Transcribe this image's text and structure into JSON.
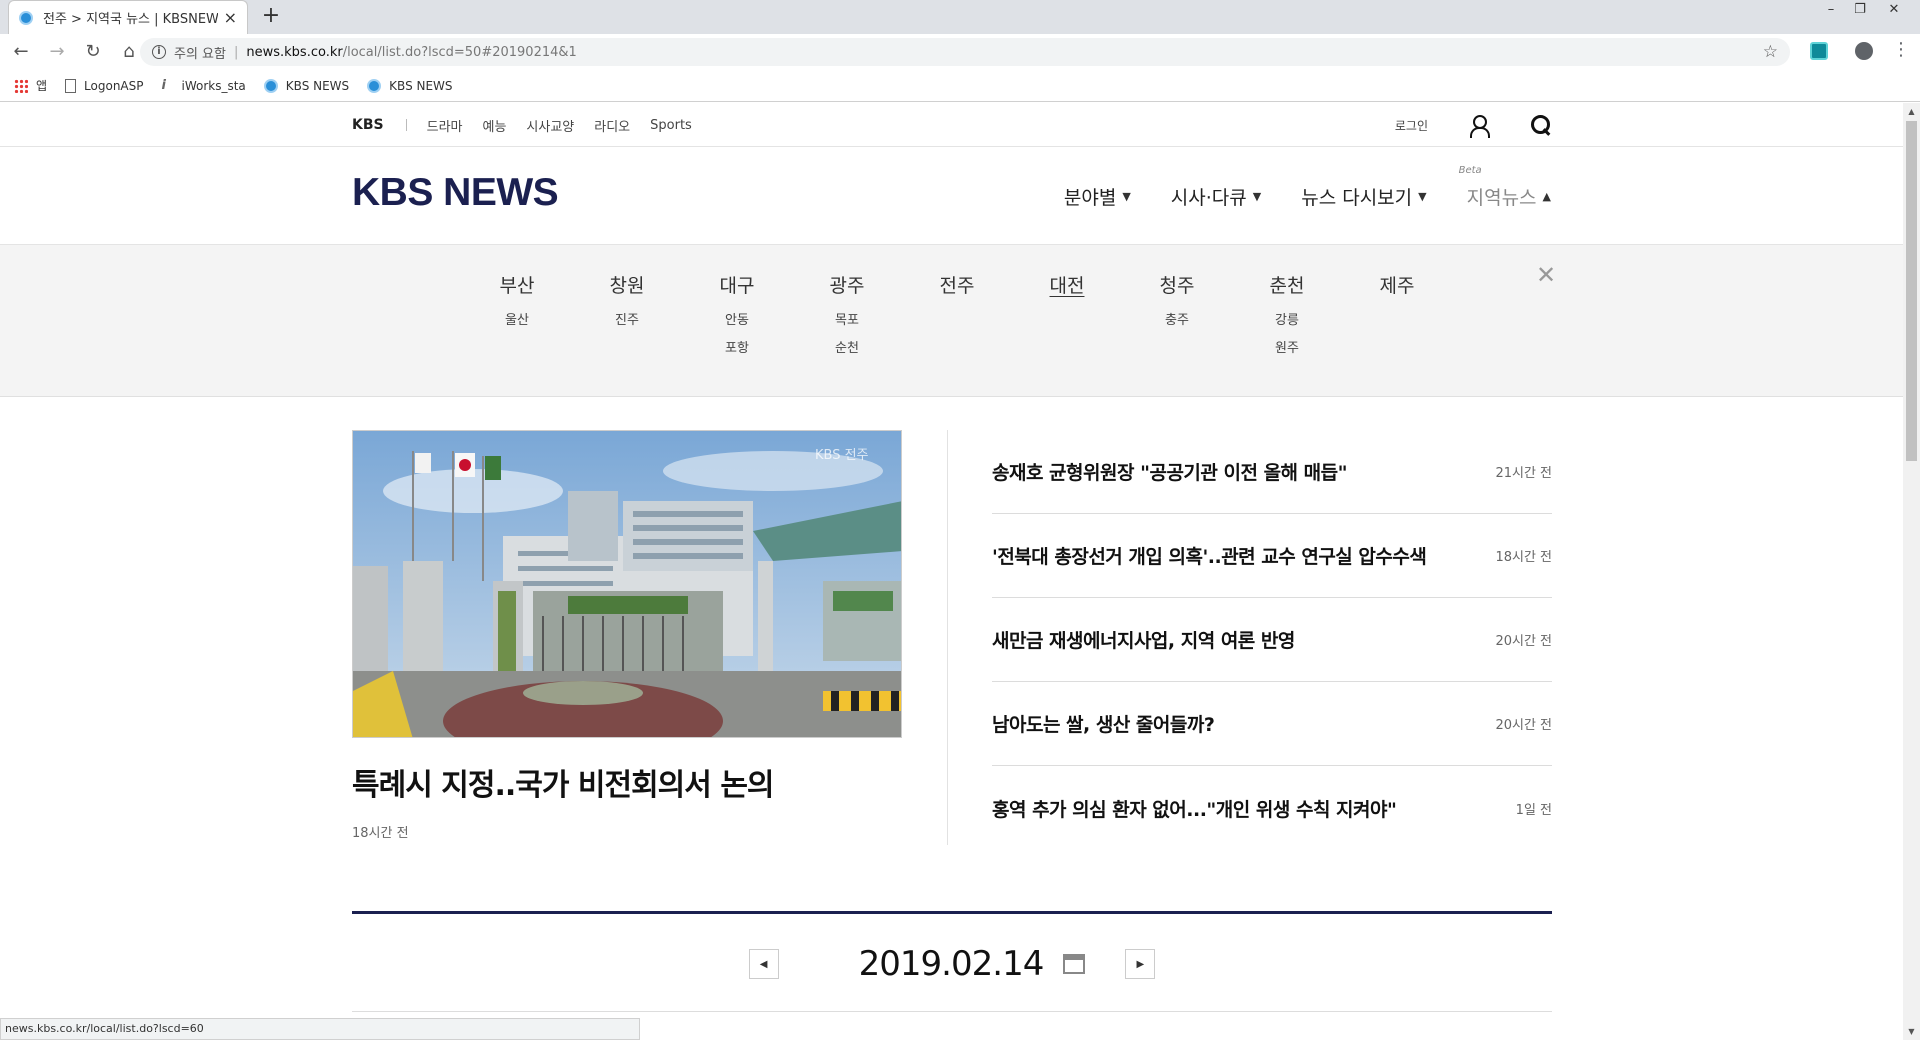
{
  "browser": {
    "tab_title": "전주 > 지역국 뉴스 | KBSNEWS",
    "tab_close": "×",
    "new_tab": "+",
    "security_warning": "주의 요함",
    "url_host": "news.kbs.co.kr",
    "url_path": "/local/list.do?lscd=50#20190214&1",
    "bookmarks": [
      {
        "label": "앱",
        "icon": "apps-icon"
      },
      {
        "label": "LogonASP",
        "icon": "document-icon"
      },
      {
        "label": "iWorks_sta",
        "icon": "iworks-icon"
      },
      {
        "label": "KBS NEWS",
        "icon": "kbs-icon"
      },
      {
        "label": "KBS NEWS",
        "icon": "kbs-icon"
      }
    ],
    "status_text": "news.kbs.co.kr/local/list.do?lscd=60"
  },
  "gnb": {
    "kbs": "KBS",
    "items": [
      "드라마",
      "예능",
      "시사교양",
      "라디오",
      "Sports"
    ],
    "login": "로그인"
  },
  "header": {
    "logo": "KBS NEWS",
    "nav": [
      {
        "label": "분야별",
        "caret": "▼"
      },
      {
        "label": "시사·다큐",
        "caret": "▼"
      },
      {
        "label": "뉴스 다시보기",
        "caret": "▼"
      },
      {
        "label": "지역뉴스",
        "caret": "▲",
        "badge": "Beta"
      }
    ]
  },
  "regions": [
    {
      "name": "부산",
      "subs": [
        "울산"
      ]
    },
    {
      "name": "창원",
      "subs": [
        "진주"
      ]
    },
    {
      "name": "대구",
      "subs": [
        "안동",
        "포항"
      ]
    },
    {
      "name": "광주",
      "subs": [
        "목포",
        "순천"
      ]
    },
    {
      "name": "전주",
      "subs": []
    },
    {
      "name": "대전",
      "subs": [],
      "current": true
    },
    {
      "name": "청주",
      "subs": [
        "충주"
      ]
    },
    {
      "name": "춘천",
      "subs": [
        "강릉",
        "원주"
      ]
    },
    {
      "name": "제주",
      "subs": []
    }
  ],
  "region_close": "✕",
  "headline": {
    "title": "특례시 지정..국가 비전회의서 논의",
    "time": "18시간 전",
    "image_watermark": "KBS 전주"
  },
  "news": [
    {
      "title": "송재호 균형위원장 \"공공기관 이전 올해 매듭\"",
      "time": "21시간 전"
    },
    {
      "title": "'전북대 총장선거 개입 의혹'..관련 교수 연구실 압수수색",
      "time": "18시간 전"
    },
    {
      "title": "새만금 재생에너지사업, 지역 여론 반영",
      "time": "20시간 전"
    },
    {
      "title": "남아도는 쌀, 생산 줄어들까?",
      "time": "20시간 전"
    },
    {
      "title": "홍역 추가 의심 환자 없어...\"개인 위생 수칙 지켜야\"",
      "time": "1일 전"
    }
  ],
  "date_nav": {
    "date": "2019.02.14",
    "prev": "◀",
    "next": "▶"
  },
  "colors": {
    "brand_navy": "#1b2050",
    "region_bg": "#f4f4f4"
  }
}
